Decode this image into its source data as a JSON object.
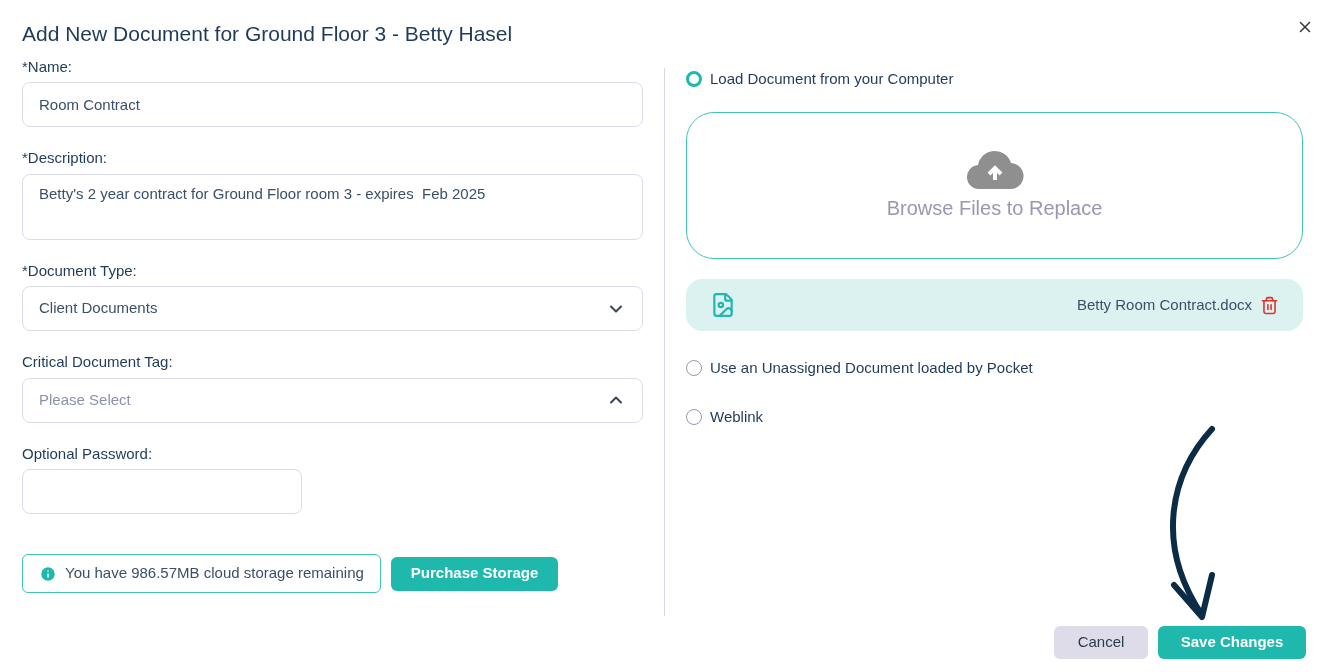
{
  "dialog": {
    "title": "Add New Document for Ground Floor 3 - Betty Hasel"
  },
  "form": {
    "fields": [
      {
        "kind": "text",
        "label": "*Name:",
        "value": "Room Contract"
      },
      {
        "kind": "textarea",
        "label": "*Description:",
        "value": "Betty's 2 year contract for Ground Floor room 3 - expires  Feb 2025"
      },
      {
        "kind": "select",
        "label": "*Document Type:",
        "value": "Client Documents",
        "expanded": false
      },
      {
        "kind": "select",
        "label": "Critical Document Tag:",
        "placeholder": "Please Select",
        "expanded": true
      },
      {
        "kind": "password",
        "label": "Optional Password:"
      }
    ],
    "storage_notice": "You have 986.57MB cloud storage remaining",
    "purchase_button": "Purchase Storage"
  },
  "source": {
    "options": [
      {
        "kind": "upload",
        "label": "Load Document from your Computer",
        "selected": true,
        "drop_zone": "Browse Files to Replace",
        "file": "Betty Room Contract.docx"
      },
      {
        "kind": "plain",
        "label": "Use an Unassigned Document loaded by Pocket",
        "selected": false
      },
      {
        "kind": "plain",
        "label": "Weblink",
        "selected": false
      }
    ]
  },
  "buttons": {
    "cancel": "Cancel",
    "save": "Save Changes"
  }
}
